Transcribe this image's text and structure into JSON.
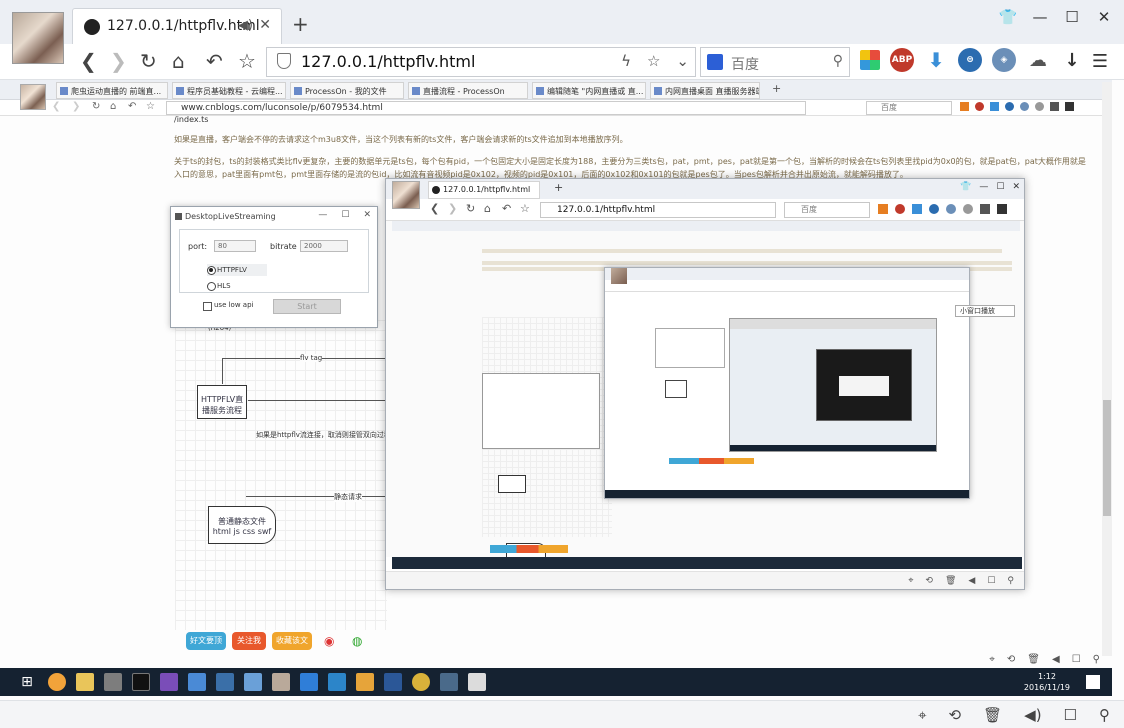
{
  "outer_browser": {
    "tab_title": "127.0.0.1/httpflv.html",
    "url": "127.0.0.1/httpflv.html",
    "search_placeholder": "百度",
    "ext_abp": "ABP"
  },
  "level1": {
    "tabs": [
      "爬虫运动直播的 前端直...",
      "程序员基础教程 - 云编程...",
      "ProcessOn - 我的文件",
      "直播流程 - ProcessOn",
      "编辑随笔 \"内网直播或 直...",
      "内网直播桌面 直播服务器端"
    ],
    "url": "www.cnblogs.com/luconsole/p/6079534.html",
    "search_placeholder": "百度",
    "text_top": "/index.ts",
    "paragraph1": "如果是直播，客户端会不停的去请求这个m3u8文件，当这个列表有新的ts文件，客户端会请求新的ts文件追加到本地播放序列。",
    "paragraph2": "关于ts的封包，ts的封装格式类比flv更复杂，主要的数据单元是ts包，每个包有pid，一个包固定大小是固定长度为188，主要分为三类ts包，pat，pmt，pes，pat就是第一个包，当解析的时候会在ts包列表里找pid为0x0的包，就是pat包，pat大概作用就是",
    "paragraph3": "入口的意思，pat里面有pmt包，pmt里面存储的是流的包id，比如流有音视频pid是0x102，视频的pid是0x101，后面的0x102和0x101的包就是pes包了。当pes包解析并合并出原始流，就能解码播放了。",
    "dialog": {
      "title": "DesktopLiveStreaming",
      "port_label": "port:",
      "port_value": "80",
      "bitrate_label": "bitrate",
      "bitrate_value": "2000",
      "radio_httpflv": "HTTPFLV",
      "radio_hls": "HLS",
      "checkbox_label": "use low api",
      "start_label": "Start"
    },
    "flow": {
      "h264": "(h264)",
      "flv_tag": "flv tag",
      "httpflv_box": "HTTPFLV直播服务流程",
      "note": "如果是httpflv流连接，取消则接管双向过程",
      "static_req": "静态请求",
      "static_file": "普通静态文件html js css swf"
    },
    "social": [
      "好文要顶",
      "关注我",
      "收藏该文"
    ],
    "task_time": "1:12",
    "task_date": "2016/11/19"
  },
  "level2": {
    "tab_title": "127.0.0.1/httpflv.html",
    "url": "127.0.0.1/httpflv.html",
    "search_placeholder": "百度",
    "pip_label": "小窗口播放"
  }
}
